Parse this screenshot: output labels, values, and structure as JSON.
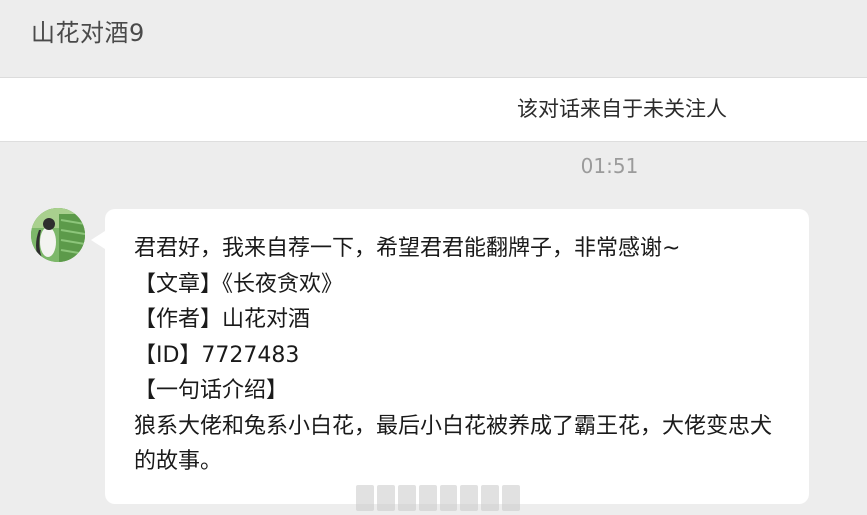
{
  "header": {
    "title": "山花对酒9"
  },
  "notice": {
    "text": "该对话来自于未关注人"
  },
  "chat": {
    "timestamp": "01:51",
    "message": {
      "lines": [
        "君君好，我来自荐一下，希望君君能翻牌子，非常感谢~",
        "【文章】《长夜贪欢》",
        "【作者】山花对酒",
        "【ID】7727483",
        "【一句话介绍】",
        "狼系大佬和兔系小白花，最后小白花被养成了霸王花，大佬变忠犬的故事。"
      ]
    }
  },
  "colors": {
    "background": "#ededed",
    "bubble": "#ffffff",
    "header_text": "#4a4a4a",
    "timestamp_text": "#9b9b9b"
  }
}
